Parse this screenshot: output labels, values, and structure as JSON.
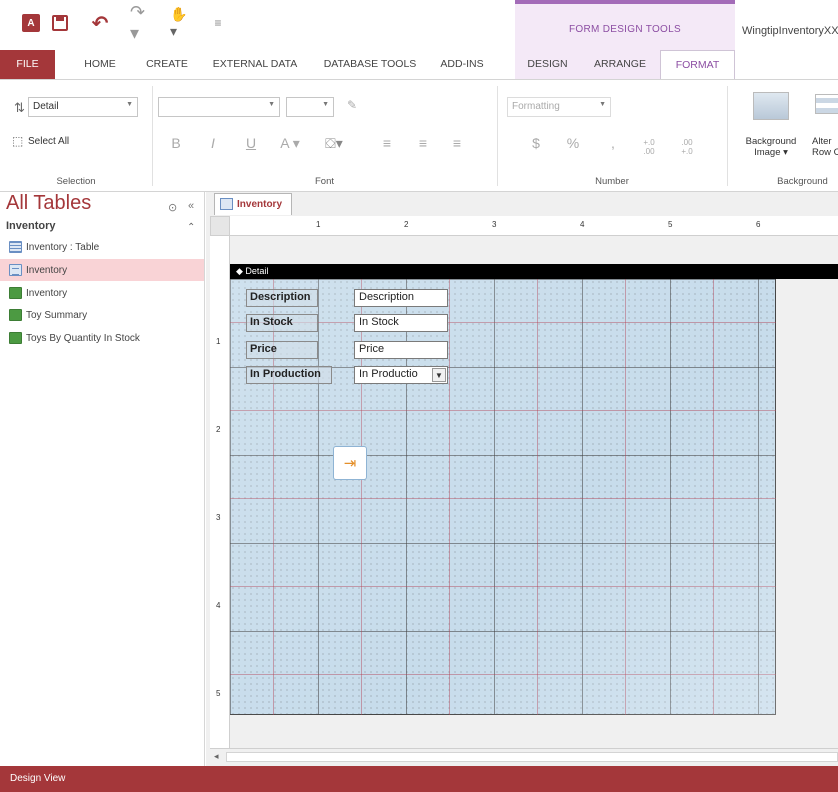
{
  "quick_access": {
    "app_icon": "access-logo-icon",
    "save_icon": "save-icon",
    "undo_icon": "undo-icon",
    "redo_icon": "redo-icon",
    "touch_icon": "touch-mode-icon",
    "customize_icon": "customize-qat-icon"
  },
  "contextual_group": {
    "title": "FORM DESIGN TOOLS",
    "accent": "#a36bb8"
  },
  "document_title": "WingtipInventoryXX",
  "tabs": [
    {
      "label": "FILE",
      "active": false
    },
    {
      "label": "HOME",
      "active": false
    },
    {
      "label": "CREATE",
      "active": false
    },
    {
      "label": "EXTERNAL DATA",
      "active": false
    },
    {
      "label": "DATABASE TOOLS",
      "active": false
    },
    {
      "label": "ADD-INS",
      "active": false
    },
    {
      "label": "DESIGN",
      "active": false
    },
    {
      "label": "ARRANGE",
      "active": false
    },
    {
      "label": "FORMAT",
      "active": true
    }
  ],
  "ribbon": {
    "selection": {
      "object_value": "Detail",
      "select_all": "Select All",
      "label": "Selection"
    },
    "font": {
      "label": "Font",
      "bold": "B",
      "italic": "I",
      "underline": "U",
      "font_color": "A",
      "fill_color": "fill-color-icon",
      "align_left": "align-left-icon",
      "align_center": "align-center-icon",
      "align_right": "align-right-icon"
    },
    "number": {
      "label": "Number",
      "formatting_placeholder": "Formatting",
      "currency": "$",
      "percent": "%",
      "comma": ",",
      "increase_decimals": "+.0 .00",
      "decrease_decimals": ".00 +.0"
    },
    "background": {
      "label": "Background",
      "background_image_line1": "Background",
      "background_image_line2": "Image ▾",
      "alt_row_line1": "Alter",
      "alt_row_line2": "Row C"
    }
  },
  "navpane": {
    "title": "All Tables",
    "group": "Inventory",
    "items": [
      {
        "label": "Inventory : Table",
        "icon": "table-icon",
        "selected": false
      },
      {
        "label": "Inventory",
        "icon": "form-icon",
        "selected": true
      },
      {
        "label": "Inventory",
        "icon": "report-icon",
        "selected": false
      },
      {
        "label": "Toy Summary",
        "icon": "report-icon",
        "selected": false
      },
      {
        "label": "Toys By Quantity In Stock",
        "icon": "report-icon",
        "selected": false
      }
    ]
  },
  "document": {
    "tab_label": "Inventory",
    "section_label": "◆ Detail",
    "ruler_h": [
      "1",
      "2",
      "3",
      "4",
      "5",
      "6"
    ],
    "ruler_v": [
      "1",
      "2",
      "3",
      "4",
      "5"
    ],
    "controls": [
      {
        "label": "Description",
        "field": "Description",
        "type": "textbox"
      },
      {
        "label": "In Stock",
        "field": "In Stock",
        "type": "textbox"
      },
      {
        "label": "Price",
        "field": "Price",
        "type": "textbox"
      },
      {
        "label": "In Production",
        "field": "In Productio",
        "type": "combobox"
      }
    ],
    "button_icon": "exit-door-icon"
  },
  "status": {
    "text": "Design View",
    "color": "#a4373a"
  }
}
